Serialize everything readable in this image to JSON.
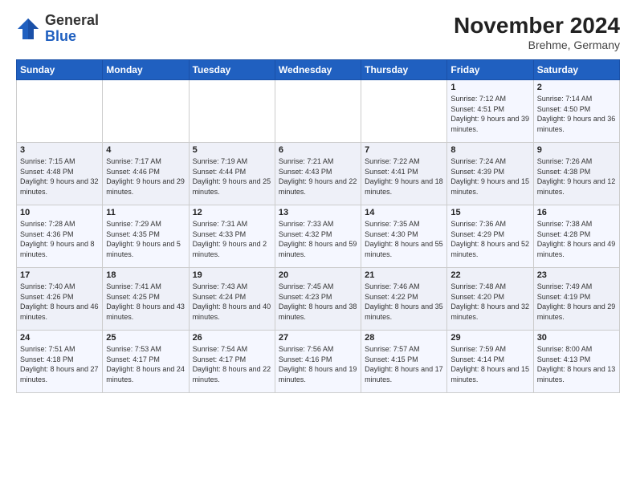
{
  "logo": {
    "general": "General",
    "blue": "Blue"
  },
  "header": {
    "month_year": "November 2024",
    "location": "Brehme, Germany"
  },
  "weekdays": [
    "Sunday",
    "Monday",
    "Tuesday",
    "Wednesday",
    "Thursday",
    "Friday",
    "Saturday"
  ],
  "weeks": [
    [
      {
        "day": "",
        "sunrise": "",
        "sunset": "",
        "daylight": ""
      },
      {
        "day": "",
        "sunrise": "",
        "sunset": "",
        "daylight": ""
      },
      {
        "day": "",
        "sunrise": "",
        "sunset": "",
        "daylight": ""
      },
      {
        "day": "",
        "sunrise": "",
        "sunset": "",
        "daylight": ""
      },
      {
        "day": "",
        "sunrise": "",
        "sunset": "",
        "daylight": ""
      },
      {
        "day": "1",
        "sunrise": "Sunrise: 7:12 AM",
        "sunset": "Sunset: 4:51 PM",
        "daylight": "Daylight: 9 hours and 39 minutes."
      },
      {
        "day": "2",
        "sunrise": "Sunrise: 7:14 AM",
        "sunset": "Sunset: 4:50 PM",
        "daylight": "Daylight: 9 hours and 36 minutes."
      }
    ],
    [
      {
        "day": "3",
        "sunrise": "Sunrise: 7:15 AM",
        "sunset": "Sunset: 4:48 PM",
        "daylight": "Daylight: 9 hours and 32 minutes."
      },
      {
        "day": "4",
        "sunrise": "Sunrise: 7:17 AM",
        "sunset": "Sunset: 4:46 PM",
        "daylight": "Daylight: 9 hours and 29 minutes."
      },
      {
        "day": "5",
        "sunrise": "Sunrise: 7:19 AM",
        "sunset": "Sunset: 4:44 PM",
        "daylight": "Daylight: 9 hours and 25 minutes."
      },
      {
        "day": "6",
        "sunrise": "Sunrise: 7:21 AM",
        "sunset": "Sunset: 4:43 PM",
        "daylight": "Daylight: 9 hours and 22 minutes."
      },
      {
        "day": "7",
        "sunrise": "Sunrise: 7:22 AM",
        "sunset": "Sunset: 4:41 PM",
        "daylight": "Daylight: 9 hours and 18 minutes."
      },
      {
        "day": "8",
        "sunrise": "Sunrise: 7:24 AM",
        "sunset": "Sunset: 4:39 PM",
        "daylight": "Daylight: 9 hours and 15 minutes."
      },
      {
        "day": "9",
        "sunrise": "Sunrise: 7:26 AM",
        "sunset": "Sunset: 4:38 PM",
        "daylight": "Daylight: 9 hours and 12 minutes."
      }
    ],
    [
      {
        "day": "10",
        "sunrise": "Sunrise: 7:28 AM",
        "sunset": "Sunset: 4:36 PM",
        "daylight": "Daylight: 9 hours and 8 minutes."
      },
      {
        "day": "11",
        "sunrise": "Sunrise: 7:29 AM",
        "sunset": "Sunset: 4:35 PM",
        "daylight": "Daylight: 9 hours and 5 minutes."
      },
      {
        "day": "12",
        "sunrise": "Sunrise: 7:31 AM",
        "sunset": "Sunset: 4:33 PM",
        "daylight": "Daylight: 9 hours and 2 minutes."
      },
      {
        "day": "13",
        "sunrise": "Sunrise: 7:33 AM",
        "sunset": "Sunset: 4:32 PM",
        "daylight": "Daylight: 8 hours and 59 minutes."
      },
      {
        "day": "14",
        "sunrise": "Sunrise: 7:35 AM",
        "sunset": "Sunset: 4:30 PM",
        "daylight": "Daylight: 8 hours and 55 minutes."
      },
      {
        "day": "15",
        "sunrise": "Sunrise: 7:36 AM",
        "sunset": "Sunset: 4:29 PM",
        "daylight": "Daylight: 8 hours and 52 minutes."
      },
      {
        "day": "16",
        "sunrise": "Sunrise: 7:38 AM",
        "sunset": "Sunset: 4:28 PM",
        "daylight": "Daylight: 8 hours and 49 minutes."
      }
    ],
    [
      {
        "day": "17",
        "sunrise": "Sunrise: 7:40 AM",
        "sunset": "Sunset: 4:26 PM",
        "daylight": "Daylight: 8 hours and 46 minutes."
      },
      {
        "day": "18",
        "sunrise": "Sunrise: 7:41 AM",
        "sunset": "Sunset: 4:25 PM",
        "daylight": "Daylight: 8 hours and 43 minutes."
      },
      {
        "day": "19",
        "sunrise": "Sunrise: 7:43 AM",
        "sunset": "Sunset: 4:24 PM",
        "daylight": "Daylight: 8 hours and 40 minutes."
      },
      {
        "day": "20",
        "sunrise": "Sunrise: 7:45 AM",
        "sunset": "Sunset: 4:23 PM",
        "daylight": "Daylight: 8 hours and 38 minutes."
      },
      {
        "day": "21",
        "sunrise": "Sunrise: 7:46 AM",
        "sunset": "Sunset: 4:22 PM",
        "daylight": "Daylight: 8 hours and 35 minutes."
      },
      {
        "day": "22",
        "sunrise": "Sunrise: 7:48 AM",
        "sunset": "Sunset: 4:20 PM",
        "daylight": "Daylight: 8 hours and 32 minutes."
      },
      {
        "day": "23",
        "sunrise": "Sunrise: 7:49 AM",
        "sunset": "Sunset: 4:19 PM",
        "daylight": "Daylight: 8 hours and 29 minutes."
      }
    ],
    [
      {
        "day": "24",
        "sunrise": "Sunrise: 7:51 AM",
        "sunset": "Sunset: 4:18 PM",
        "daylight": "Daylight: 8 hours and 27 minutes."
      },
      {
        "day": "25",
        "sunrise": "Sunrise: 7:53 AM",
        "sunset": "Sunset: 4:17 PM",
        "daylight": "Daylight: 8 hours and 24 minutes."
      },
      {
        "day": "26",
        "sunrise": "Sunrise: 7:54 AM",
        "sunset": "Sunset: 4:17 PM",
        "daylight": "Daylight: 8 hours and 22 minutes."
      },
      {
        "day": "27",
        "sunrise": "Sunrise: 7:56 AM",
        "sunset": "Sunset: 4:16 PM",
        "daylight": "Daylight: 8 hours and 19 minutes."
      },
      {
        "day": "28",
        "sunrise": "Sunrise: 7:57 AM",
        "sunset": "Sunset: 4:15 PM",
        "daylight": "Daylight: 8 hours and 17 minutes."
      },
      {
        "day": "29",
        "sunrise": "Sunrise: 7:59 AM",
        "sunset": "Sunset: 4:14 PM",
        "daylight": "Daylight: 8 hours and 15 minutes."
      },
      {
        "day": "30",
        "sunrise": "Sunrise: 8:00 AM",
        "sunset": "Sunset: 4:13 PM",
        "daylight": "Daylight: 8 hours and 13 minutes."
      }
    ]
  ]
}
